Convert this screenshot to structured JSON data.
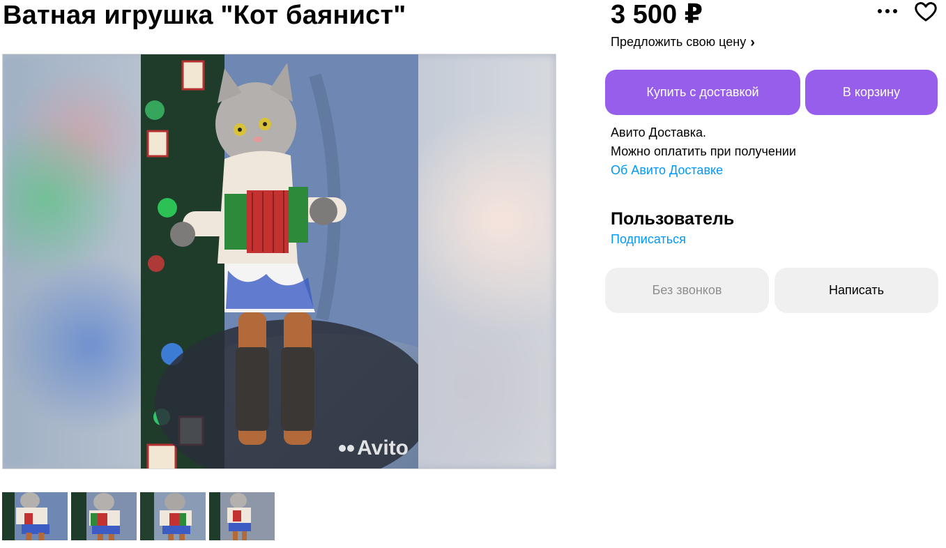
{
  "listing": {
    "title": "Ватная игрушка \"Кот баянист\"",
    "price": "3 500 ₽",
    "offer_price_label": "Предложить свою цену",
    "buy_with_delivery_label": "Купить с доставкой",
    "add_to_cart_label": "В корзину"
  },
  "delivery": {
    "line1": "Авито Доставка.",
    "line2": "Можно оплатить при получении",
    "link": "Об Авито Доставке"
  },
  "seller": {
    "name": "Пользователь",
    "subscribe_label": "Подписаться",
    "no_calls_label": "Без звонков",
    "write_label": "Написать"
  },
  "gallery": {
    "watermark": "Avito",
    "thumbnail_count": 4,
    "active_thumbnail": 1
  },
  "icons": {
    "more": "more-dots-icon",
    "favorite": "heart-icon",
    "offer_chevron": "chevron-right-icon"
  },
  "colors": {
    "primary_button": "#965eeb",
    "link": "#0099f7",
    "secondary_button": "#f0f0f0",
    "thumbnail_active_border": "#00aaff"
  }
}
